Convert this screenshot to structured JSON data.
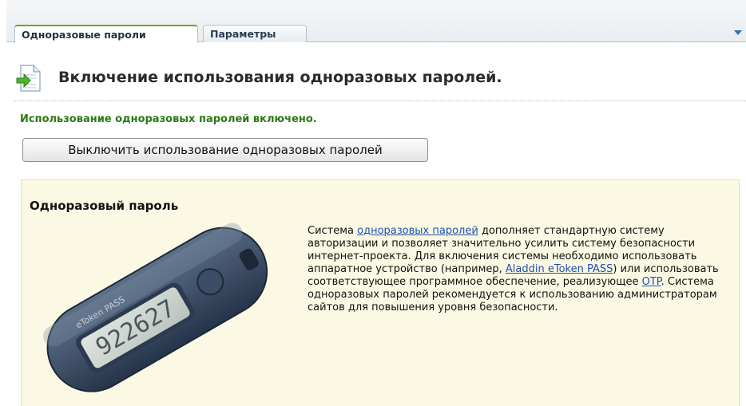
{
  "tabs": [
    {
      "label": "Одноразовые пароли",
      "active": true
    },
    {
      "label": "Параметры",
      "active": false
    }
  ],
  "header": {
    "title": "Включение использования одноразовых паролей.",
    "icon": "document-arrow-icon"
  },
  "status": {
    "text": "Использование одноразовых паролей включено.",
    "color": "#2b7a12"
  },
  "disable_button": {
    "label": "Выключить использование одноразовых паролей"
  },
  "info": {
    "title": "Одноразовый пароль",
    "image_icon": "otp-token-device-icon",
    "token_display": "922627",
    "token_brand": "eToken PASS",
    "text_parts": {
      "p1": "Система ",
      "link1": "одноразовых паролей",
      "p2": " дополняет стандартную систему авторизации и позволяет значительно усилить систему безопасности интернет-проекта. Для включения системы необходимо использовать аппаратное устройство (например, ",
      "link2": "Aladdin eToken PASS",
      "p3": ") или использовать соответствующее программное обеспечение, реализующее ",
      "link3": "OTP",
      "p4": ". Система одноразовых паролей рекомендуется к использованию администраторам сайтов для повышения уровня безопасности."
    }
  },
  "colors": {
    "link": "#1f4fb3",
    "info_bg": "#fbf9e3",
    "active_tab_accent": "#6aa52c"
  }
}
